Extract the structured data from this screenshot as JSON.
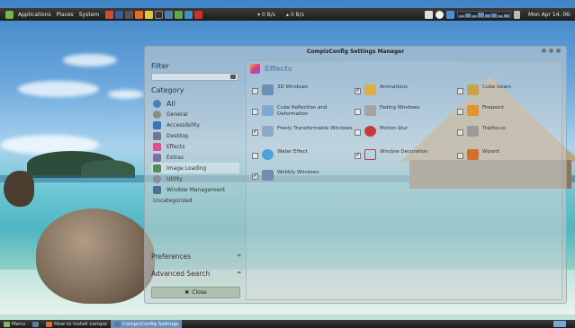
{
  "top_panel": {
    "menus": [
      "Applications",
      "Places",
      "System"
    ],
    "net_down": "0 B/s",
    "net_up": "0 B/s",
    "clock": "Mon Apr 14, 06:"
  },
  "window": {
    "title": "CompizConfig Settings Manager"
  },
  "sidebar": {
    "filter_label": "Filter",
    "filter_value": "",
    "category_label": "Category",
    "categories": [
      {
        "label": "All",
        "icon": "all-icon",
        "color": "#4a7fb8"
      },
      {
        "label": "General",
        "icon": "general-icon",
        "color": "#8a8a8a"
      },
      {
        "label": "Accessibility",
        "icon": "accessibility-icon",
        "color": "#3d74b5"
      },
      {
        "label": "Desktop",
        "icon": "desktop-icon",
        "color": "#6b7b8c"
      },
      {
        "label": "Effects",
        "icon": "effects-icon",
        "color": "#d9508a"
      },
      {
        "label": "Extras",
        "icon": "extras-icon",
        "color": "#7a6fa0"
      },
      {
        "label": "Image Loading",
        "icon": "image-loading-icon",
        "color": "#5a8a5a"
      },
      {
        "label": "Utility",
        "icon": "utility-icon",
        "color": "#8c8c9c"
      },
      {
        "label": "Window Management",
        "icon": "window-management-icon",
        "color": "#4d6f96"
      },
      {
        "label": "Uncategorized",
        "icon": "",
        "color": "transparent"
      }
    ],
    "preferences_label": "Preferences",
    "advanced_search_label": "Advanced Search",
    "close_label": "Close"
  },
  "main": {
    "heading": "Effects",
    "plugins": [
      {
        "label": "3D Windows",
        "checked": false,
        "icon_color": "#6b8fb5"
      },
      {
        "label": "Animations",
        "checked": true,
        "icon_color": "#e0b13a"
      },
      {
        "label": "Cube Gears",
        "checked": false,
        "icon_color": "#c9a24a"
      },
      {
        "label": "Cube Reflection and Deformation",
        "checked": false,
        "icon_color": "#7fa9d1"
      },
      {
        "label": "Fading Windows",
        "checked": false,
        "icon_color": "#a3a3a3"
      },
      {
        "label": "Firepaint",
        "checked": false,
        "icon_color": "#e3952c"
      },
      {
        "label": "Freely Transformable Windows",
        "checked": true,
        "icon_color": "#8ea8c8"
      },
      {
        "label": "Motion blur",
        "checked": false,
        "icon_color": "#c73a3a"
      },
      {
        "label": "Trailfocus",
        "checked": false,
        "icon_color": "#9a9a9a"
      },
      {
        "label": "Water Effect",
        "checked": false,
        "icon_color": "#4aa3d8"
      },
      {
        "label": "Window Decoration",
        "checked": true,
        "icon_color": "#c0306a"
      },
      {
        "label": "Wizard",
        "checked": false,
        "icon_color": "#d56e2b"
      },
      {
        "label": "Wobbly Windows",
        "checked": true,
        "icon_color": "#6f8fb0"
      }
    ]
  },
  "bottom_panel": {
    "menu_label": "Menu",
    "tasks": [
      {
        "label": "How to install compiz",
        "active": false
      },
      {
        "label": "CompizConfig Settings",
        "active": true
      }
    ]
  }
}
